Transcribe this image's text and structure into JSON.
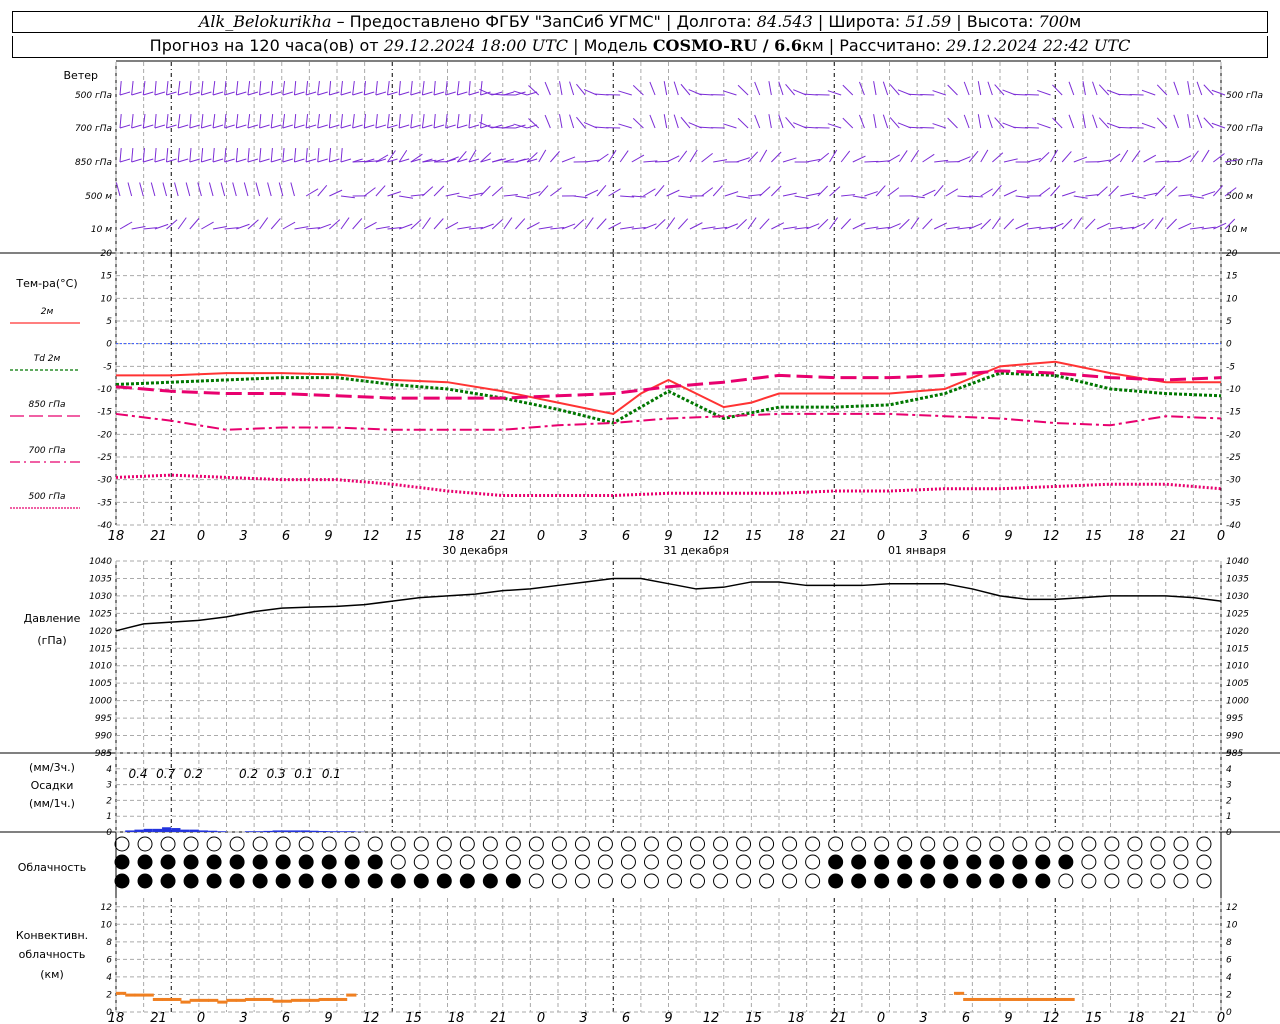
{
  "header": {
    "station": "Alk_Belokurikha",
    "provided": " – Предоставлено ФГБУ \"ЗапСиб УГМС\" | Долгота: ",
    "lon": "84.543",
    "lat_label": " | Широта: ",
    "lat": "51.59",
    "alt_label": " | Высота: ",
    "alt": "700",
    "alt_unit": "м",
    "line2_a": "Прогноз на 120 часа(ов) от ",
    "run": "29.12.2024 18:00 UTC",
    "line2_b": "  | Модель ",
    "model": "COSMO-RU / 6.6",
    "model_unit": "км",
    "line2_c": " | Рассчитано: ",
    "calc": "29.12.2024 22:42 UTC"
  },
  "wind_panel": {
    "title": "Ветер",
    "levels": [
      "500 гПа",
      "700 гПа",
      "850 гПа",
      "500 м",
      "10  м"
    ]
  },
  "time_axis": {
    "hour_labels": [
      "18",
      "21",
      "0",
      "3",
      "6",
      "9",
      "12",
      "15",
      "18",
      "21",
      "0",
      "3",
      "6",
      "9",
      "12",
      "15",
      "18",
      "21",
      "0",
      "3",
      "6",
      "9",
      "12",
      "15",
      "18",
      "21",
      "0"
    ],
    "day_labels": [
      "30 декабря",
      "31 декабря",
      "01 января"
    ]
  },
  "temp_panel": {
    "title": "Тем-ра(°C)",
    "legend": [
      {
        "label": "2м",
        "color": "#ff3333",
        "style": "solid"
      },
      {
        "label": "Td  2м",
        "color": "#007700",
        "style": "dotted"
      },
      {
        "label": "850 гПа",
        "color": "#e8006e",
        "style": "longdash"
      },
      {
        "label": "700 гПа",
        "color": "#e8006e",
        "style": "dashdot"
      },
      {
        "label": "500 гПа",
        "color": "#e8006e",
        "style": "dense-dot"
      }
    ],
    "y_ticks": [
      "20",
      "15",
      "10",
      "5",
      "0",
      "-5",
      "-10",
      "-15",
      "-20",
      "-25",
      "-30",
      "-35",
      "-40"
    ]
  },
  "pressure_panel": {
    "title": "Давление",
    "unit": "(гПа)",
    "y_ticks": [
      "1040",
      "1035",
      "1030",
      "1025",
      "1020",
      "1015",
      "1010",
      "1005",
      "1000",
      "995",
      "990",
      "985"
    ]
  },
  "precip_panel": {
    "unit3": "(мм/3ч.)",
    "title": "Осадки",
    "unit1": "(мм/1ч.)",
    "y_ticks": [
      "5",
      "4",
      "3",
      "2",
      "1",
      "0"
    ],
    "labels": [
      {
        "hour": 3,
        "text": "0.4"
      },
      {
        "hour": 6,
        "text": "0.7"
      },
      {
        "hour": 9,
        "text": "0.2"
      },
      {
        "hour": 15,
        "text": "0.2"
      },
      {
        "hour": 18,
        "text": "0.3"
      },
      {
        "hour": 21,
        "text": "0.1"
      },
      {
        "hour": 24,
        "text": "0.1"
      }
    ]
  },
  "cloud_panel": {
    "title": "Облачность"
  },
  "conv_panel": {
    "title1": "Конвективн.",
    "title2": "облачность",
    "unit": "(км)",
    "y_ticks": [
      "12",
      "10",
      "8",
      "6",
      "4",
      "2",
      "0"
    ]
  },
  "chart_data": [
    {
      "type": "line",
      "title": "Тем-ра(°C)",
      "ylim": [
        -40,
        20
      ],
      "x_unit": "hours from 29.12.2024 18:00 UTC",
      "series": [
        {
          "name": "2м",
          "x": [
            0,
            6,
            12,
            18,
            24,
            30,
            36,
            42,
            48,
            54,
            57,
            60,
            66,
            69,
            72,
            78,
            84,
            90,
            96,
            102,
            108,
            114,
            120
          ],
          "values": [
            -7,
            -7,
            -6.5,
            -6.5,
            -6.8,
            -8,
            -8.5,
            -10.5,
            -13,
            -15.5,
            -11,
            -8,
            -14,
            -13,
            -11,
            -11,
            -11,
            -10,
            -5,
            -4,
            -6.5,
            -8.5,
            -8.5
          ]
        },
        {
          "name": "Td  2м",
          "x": [
            0,
            6,
            12,
            18,
            24,
            30,
            36,
            42,
            48,
            54,
            60,
            66,
            72,
            78,
            84,
            90,
            96,
            102,
            108,
            114,
            120
          ],
          "values": [
            -9,
            -8.5,
            -8,
            -7.5,
            -7.5,
            -9,
            -10,
            -12,
            -14.5,
            -17.5,
            -10.5,
            -16.5,
            -14,
            -14,
            -13.5,
            -11,
            -6.5,
            -7,
            -10,
            -11,
            -11.5
          ]
        },
        {
          "name": "850 гПа",
          "x": [
            0,
            6,
            12,
            18,
            24,
            30,
            36,
            42,
            48,
            54,
            60,
            66,
            72,
            78,
            84,
            90,
            96,
            102,
            108,
            114,
            120
          ],
          "values": [
            -9.5,
            -10.5,
            -11,
            -11,
            -11.5,
            -12,
            -12,
            -12,
            -11.5,
            -11,
            -9.5,
            -8.5,
            -7,
            -7.5,
            -7.5,
            -7,
            -6,
            -6.5,
            -7.5,
            -8,
            -7.5
          ]
        },
        {
          "name": "700 гПа",
          "x": [
            0,
            6,
            12,
            18,
            24,
            30,
            36,
            42,
            48,
            54,
            60,
            66,
            72,
            78,
            84,
            90,
            96,
            102,
            108,
            114,
            120
          ],
          "values": [
            -15.5,
            -17,
            -19,
            -18.5,
            -18.5,
            -19,
            -19,
            -19,
            -18,
            -17.5,
            -16.5,
            -16,
            -15.5,
            -15.5,
            -15.5,
            -16,
            -16.5,
            -17.5,
            -18,
            -16,
            -16.5
          ]
        },
        {
          "name": "500 гПа",
          "x": [
            0,
            6,
            12,
            18,
            24,
            30,
            36,
            42,
            48,
            54,
            60,
            66,
            72,
            78,
            84,
            90,
            96,
            102,
            108,
            114,
            120
          ],
          "values": [
            -29.5,
            -29,
            -29.5,
            -30,
            -30,
            -31,
            -32.5,
            -33.5,
            -33.5,
            -33.5,
            -33,
            -33,
            -33,
            -32.5,
            -32.5,
            -32,
            -32,
            -31.5,
            -31,
            -31,
            -32
          ]
        }
      ]
    },
    {
      "type": "line",
      "title": "Давление",
      "ylabel": "(гПа)",
      "ylim": [
        985,
        1040
      ],
      "x": [
        0,
        3,
        6,
        9,
        12,
        15,
        18,
        21,
        24,
        27,
        30,
        33,
        36,
        39,
        42,
        45,
        48,
        51,
        54,
        57,
        60,
        63,
        66,
        69,
        72,
        75,
        78,
        81,
        84,
        87,
        90,
        93,
        96,
        99,
        102,
        105,
        108,
        111,
        114,
        117,
        120
      ],
      "values": [
        1020,
        1022,
        1022.5,
        1023,
        1024,
        1025.5,
        1026.5,
        1026.8,
        1027,
        1027.5,
        1028.5,
        1029.5,
        1030,
        1030.5,
        1031.5,
        1032,
        1033,
        1034,
        1035,
        1035,
        1033.5,
        1032,
        1032.5,
        1034,
        1034,
        1033,
        1033,
        1033,
        1033.5,
        1033.5,
        1033.5,
        1032,
        1030,
        1029,
        1029,
        1029.5,
        1030,
        1030,
        1030,
        1029.5,
        1028.5
      ]
    },
    {
      "type": "bar",
      "title": "Осадки",
      "ylim": [
        0,
        5
      ],
      "x": [
        1,
        2,
        3,
        4,
        5,
        6,
        7,
        8,
        9,
        10,
        11,
        12,
        13,
        14,
        15,
        16,
        17,
        18,
        19,
        20,
        21,
        22,
        23,
        24,
        25,
        26
      ],
      "values": [
        0.1,
        0.15,
        0.2,
        0.2,
        0.3,
        0.25,
        0.15,
        0.15,
        0.1,
        0.08,
        0.05,
        0,
        0,
        0.05,
        0.05,
        0.07,
        0.1,
        0.1,
        0.1,
        0.1,
        0.08,
        0.06,
        0.05,
        0.05,
        0.05,
        0.02
      ]
    },
    {
      "type": "bar",
      "title": "Конвективн. облачность",
      "ylabel": "(км)",
      "ylim": [
        0,
        13
      ],
      "x": [
        1,
        2,
        3,
        4,
        5,
        6,
        7,
        8,
        9,
        10,
        11,
        12,
        13,
        14,
        15,
        16,
        17,
        18,
        19,
        20,
        21,
        22,
        23,
        24,
        25,
        26,
        27,
        28,
        29,
        30,
        31,
        32,
        33,
        34,
        35,
        36,
        37,
        38,
        39
      ],
      "base": [
        2,
        1.8,
        1.8,
        1.8,
        1.3,
        1.3,
        1.3,
        1,
        1.2,
        1.2,
        1.2,
        1,
        1.2,
        1.2,
        1.3,
        1.3,
        1.3,
        1.1,
        1.1,
        1.2,
        1.2,
        1.2,
        1.3,
        1.3,
        1.3,
        1.8,
        2,
        1.3,
        1.3,
        1.3,
        1.3,
        1.3,
        1.3,
        1.3,
        1.3,
        1.3,
        1.3,
        1.3,
        1.3
      ],
      "top": [
        2.3,
        2.1,
        2.1,
        2.1,
        1.6,
        1.6,
        1.6,
        1.3,
        1.5,
        1.5,
        1.5,
        1.3,
        1.5,
        1.5,
        1.6,
        1.6,
        1.6,
        1.4,
        1.4,
        1.5,
        1.5,
        1.5,
        1.6,
        1.6,
        1.6,
        2.1,
        2.3,
        1.6,
        1.6,
        1.6,
        1.6,
        1.6,
        1.6,
        1.6,
        1.6,
        1.6,
        1.6,
        1.6,
        1.6
      ]
    }
  ]
}
